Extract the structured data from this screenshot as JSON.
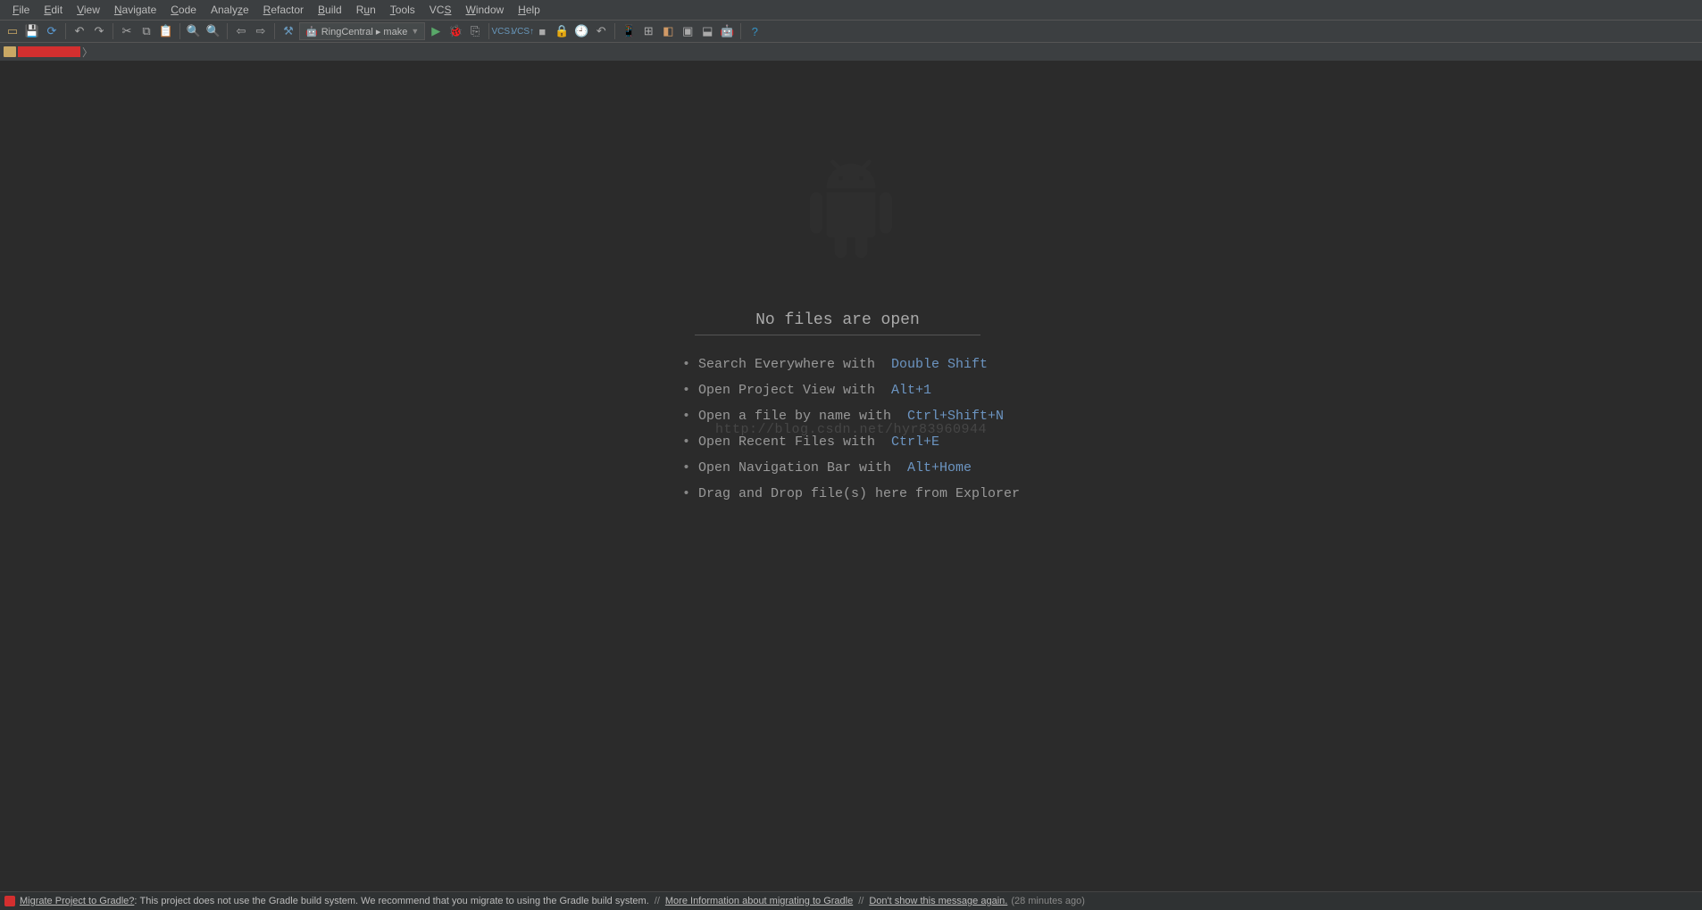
{
  "menubar": {
    "file": "File",
    "edit": "Edit",
    "view": "View",
    "navigate": "Navigate",
    "code": "Code",
    "analyze": "Analyze",
    "refactor": "Refactor",
    "build": "Build",
    "run": "Run",
    "tools": "Tools",
    "vcs": "VCS",
    "window": "Window",
    "help": "Help"
  },
  "toolbar": {
    "run_config_label": "RingCentral ▸ make"
  },
  "empty_editor": {
    "title": "No files are open",
    "tips": [
      {
        "text": "Search Everywhere with",
        "key": "Double Shift"
      },
      {
        "text": "Open Project View with",
        "key": "Alt+1"
      },
      {
        "text": "Open a file by name with",
        "key": "Ctrl+Shift+N"
      },
      {
        "text": "Open Recent Files with",
        "key": "Ctrl+E"
      },
      {
        "text": "Open Navigation Bar with",
        "key": "Alt+Home"
      },
      {
        "text": "Drag and Drop file(s) here from Explorer",
        "key": ""
      }
    ],
    "watermark": "http://blog.csdn.net/hyr83960944"
  },
  "notification": {
    "title": "Migrate Project to Gradle?",
    "body": "This project does not use the Gradle build system. We recommend that you migrate to using the Gradle build system.",
    "link1": "More Information about migrating to Gradle",
    "link2": "Don't show this message again.",
    "time": "(28 minutes ago)"
  }
}
